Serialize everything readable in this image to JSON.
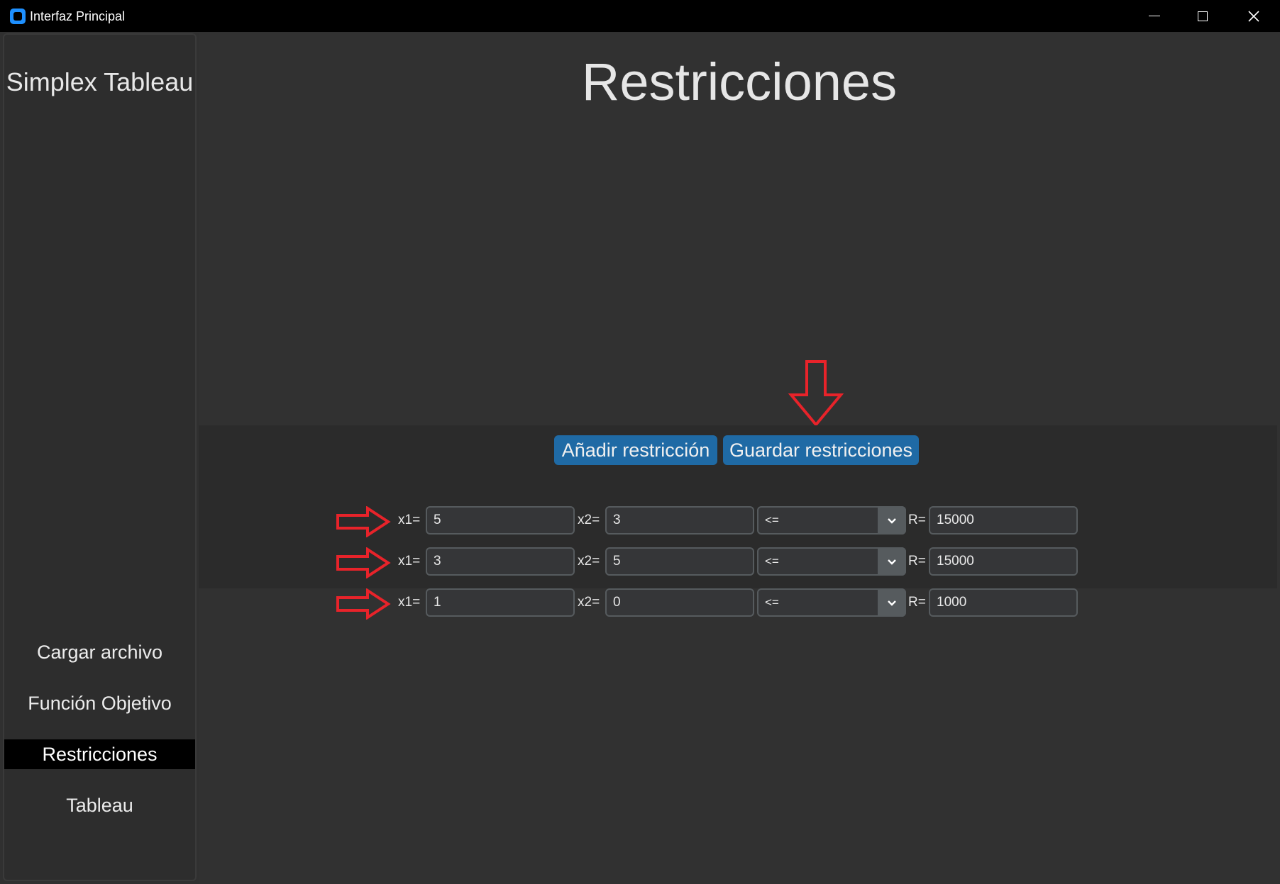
{
  "window": {
    "title": "Interfaz Principal"
  },
  "sidebar": {
    "brand": "Simplex Tableau",
    "items": [
      {
        "label": "Cargar archivo",
        "active": false
      },
      {
        "label": "Función Objetivo",
        "active": false
      },
      {
        "label": "Restricciones",
        "active": true
      },
      {
        "label": "Tableau",
        "active": false
      }
    ]
  },
  "main": {
    "title": "Restricciones",
    "buttons": {
      "add": "Añadir restricción",
      "save": "Guardar restricciones"
    },
    "labels": {
      "x1": "x1=",
      "x2": "x2=",
      "r": "R="
    },
    "constraints": [
      {
        "x1": "5",
        "x2": "3",
        "op": "<=",
        "r": "15000"
      },
      {
        "x1": "3",
        "x2": "5",
        "op": "<=",
        "r": "15000"
      },
      {
        "x1": "1",
        "x2": "0",
        "op": "<=",
        "r": "1000"
      }
    ]
  },
  "colors": {
    "accent": "#1f6aa5",
    "annotation": "#e8232a"
  }
}
